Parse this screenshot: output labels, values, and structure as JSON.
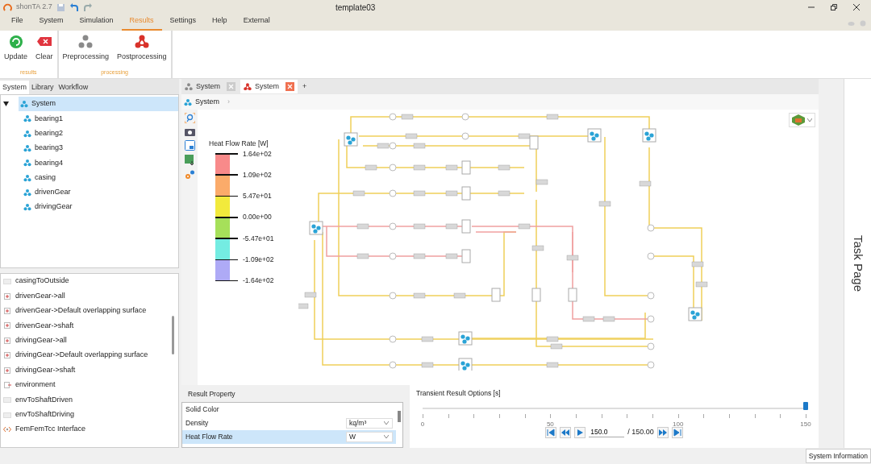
{
  "title_bar": {
    "app": "shonTA 2.7",
    "title": "template03"
  },
  "menu": [
    {
      "label": "File",
      "selected": false
    },
    {
      "label": "System",
      "selected": false
    },
    {
      "label": "Simulation",
      "selected": false
    },
    {
      "label": "Results",
      "selected": true
    },
    {
      "label": "Settings",
      "selected": false
    },
    {
      "label": "Help",
      "selected": false
    },
    {
      "label": "External",
      "selected": false
    }
  ],
  "ribbon": {
    "groups": [
      {
        "label": "results",
        "buttons": [
          {
            "label": "Update",
            "kind": "update"
          },
          {
            "label": "Clear",
            "kind": "clear"
          }
        ]
      },
      {
        "label": "processing",
        "buttons": [
          {
            "label": "Preprocessing",
            "kind": "pre"
          },
          {
            "label": "Postprocessing",
            "kind": "post"
          }
        ]
      }
    ]
  },
  "left_tabs": [
    {
      "label": "System",
      "selected": true
    },
    {
      "label": "Library",
      "selected": false
    },
    {
      "label": "Workflow",
      "selected": false
    }
  ],
  "tree": {
    "label": "System",
    "expanded": true,
    "selected": true,
    "children": [
      {
        "label": "bearing1",
        "selected": false
      },
      {
        "label": "bearing2",
        "selected": false
      },
      {
        "label": "bearing3",
        "selected": false
      },
      {
        "label": "bearing4",
        "selected": false
      },
      {
        "label": "casing",
        "selected": false
      },
      {
        "label": "drivenGear",
        "selected": false
      },
      {
        "label": "drivingGear",
        "selected": false
      }
    ]
  },
  "list": [
    {
      "label": "casingToOutside",
      "kind": "plain"
    },
    {
      "label": "drivenGear->all",
      "kind": "plus"
    },
    {
      "label": "drivenGear->Default overlapping surface",
      "kind": "plus"
    },
    {
      "label": "drivenGear->shaft",
      "kind": "plus"
    },
    {
      "label": "drivingGear->all",
      "kind": "plus"
    },
    {
      "label": "drivingGear->Default overlapping surface",
      "kind": "plus"
    },
    {
      "label": "drivingGear->shaft",
      "kind": "plus"
    },
    {
      "label": "environment",
      "kind": "env"
    },
    {
      "label": "envToShaftDriven",
      "kind": "plain"
    },
    {
      "label": "envToShaftDriving",
      "kind": "plain"
    },
    {
      "label": "FemFemTcc Interface",
      "kind": "interface"
    }
  ],
  "doc_tabs": [
    {
      "label": "System",
      "selected": false,
      "kind": "pre"
    },
    {
      "label": "System",
      "selected": true,
      "kind": "post"
    }
  ],
  "add_tab": "+",
  "breadcrumb": {
    "label": "System",
    "separator": "›"
  },
  "legend": {
    "title": "Heat Flow Rate [W]",
    "ticks": [
      "1.64e+02",
      "1.09e+02",
      "5.47e+01",
      "0.00e+00",
      "-5.47e+01",
      "-1.09e+02",
      "-1.64e+02"
    ],
    "bands": [
      {
        "color": "#f88a8a"
      },
      {
        "color": "#fbab6a"
      },
      {
        "color": "#f2ea3c"
      },
      {
        "color": "#a6e05a"
      },
      {
        "color": "#74ece2"
      },
      {
        "color": "#aeaaf6"
      }
    ]
  },
  "result_property": {
    "title": "Result Property",
    "rows": [
      {
        "label": "Solid Color",
        "selected": false
      },
      {
        "label": "Density",
        "unit": "kq/m³",
        "selected": false
      },
      {
        "label": "Heat Flow Rate",
        "unit": "W",
        "selected": true
      }
    ]
  },
  "transient": {
    "title": "Transient Result Options [s]",
    "level": 1,
    "tick_labels": [
      "0",
      "50",
      "100",
      "150"
    ],
    "time": "150.0",
    "total": "/ 150.00"
  },
  "task_page": "Task Page",
  "status_bar": "System Information"
}
